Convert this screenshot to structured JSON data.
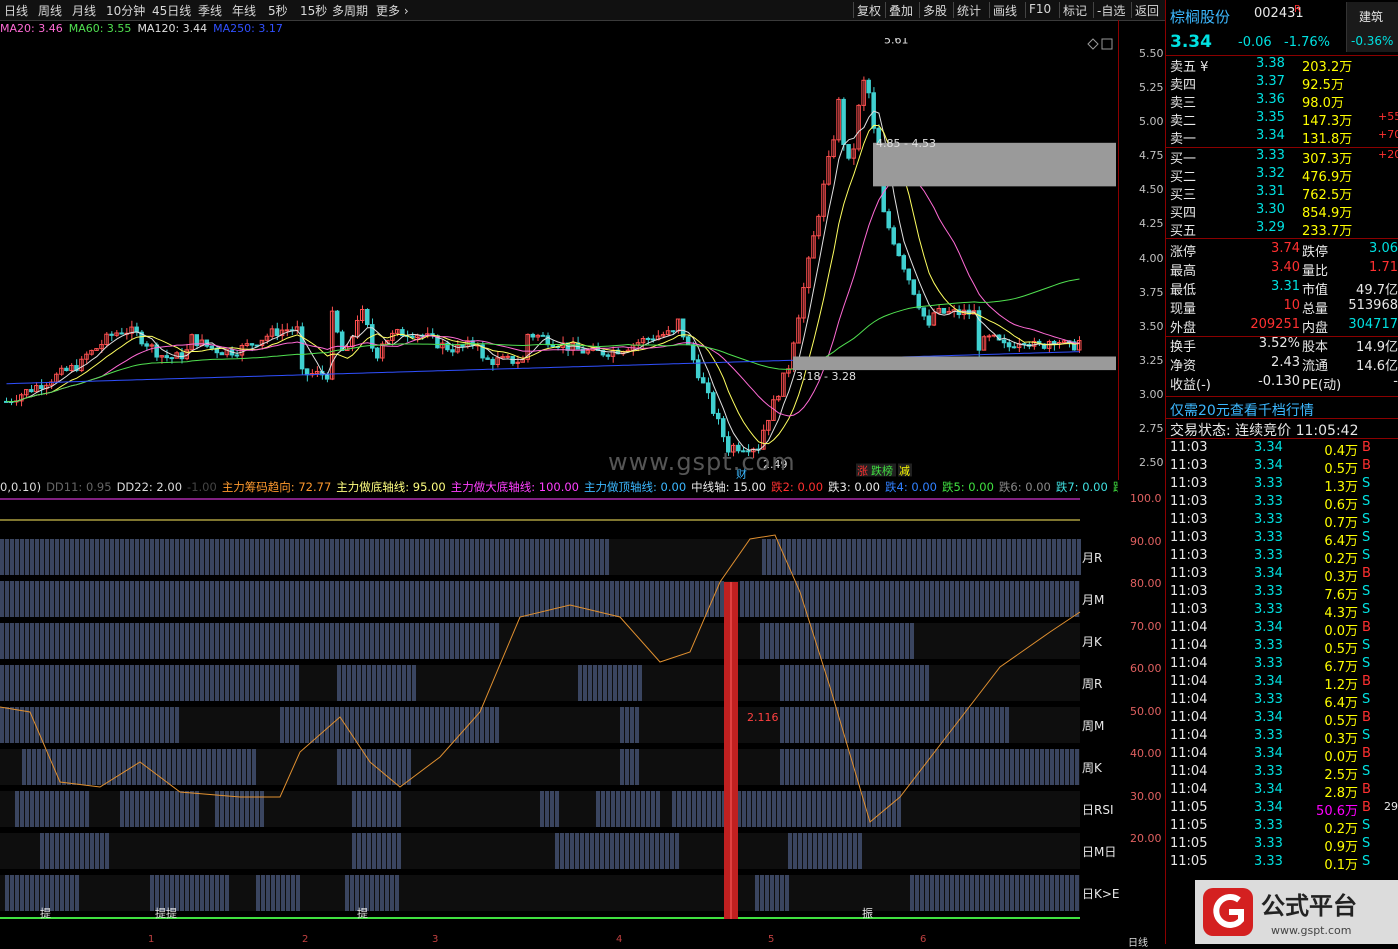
{
  "toolbar": {
    "left": [
      "日线",
      "周线",
      "月线",
      "10分钟",
      "45日线",
      "季线",
      "年线",
      "5秒",
      "15秒",
      "多周期",
      "更多"
    ],
    "right": [
      "复权",
      "叠加",
      "多股",
      "统计",
      "画线",
      "F10",
      "标记",
      "-自选",
      "返回"
    ]
  },
  "ma_legend": [
    {
      "label": "MA20: 3.46",
      "color": "#ff6ad5"
    },
    {
      "label": "MA60: 3.55",
      "color": "#50e050"
    },
    {
      "label": "MA120: 3.44",
      "color": "#e0e0e0"
    },
    {
      "label": "MA250: 3.17",
      "color": "#3050ff"
    }
  ],
  "price_axis": {
    "min": 2.38,
    "max": 5.62,
    "ticks": [
      "5.50",
      "5.25",
      "5.00",
      "4.75",
      "4.50",
      "4.25",
      "4.00",
      "3.75",
      "3.50",
      "3.25",
      "3.00",
      "2.75",
      "2.50"
    ]
  },
  "annotations": {
    "high": "5.61",
    "zone_upper": "4.85 - 4.53",
    "zone_lower": "3.18 - 3.28",
    "low": "2.49",
    "cai": "财",
    "tags": [
      "涨",
      "跌榜",
      "减"
    ]
  },
  "watermark": "www.gspt.com",
  "indicator_bar": [
    {
      "t": "0,0.10)",
      "c": "#ddd"
    },
    {
      "t": "DD11: 0.95",
      "c": "#666"
    },
    {
      "t": "DD22: 2.00",
      "c": "#ddd"
    },
    {
      "t": "-1.00",
      "c": "#444"
    },
    {
      "t": "主力筹码趋向: 72.77",
      "c": "#ff9a2e"
    },
    {
      "t": "主力做底轴线: 95.00",
      "c": "#ffff80"
    },
    {
      "t": "主力做大底轴线: 100.00",
      "c": "#ff40ff"
    },
    {
      "t": "主力做顶轴线: 0.00",
      "c": "#3cb8ff"
    },
    {
      "t": "中线轴: 15.00",
      "c": "#e8e8e8"
    },
    {
      "t": "跌2: 0.00",
      "c": "#ff3030"
    },
    {
      "t": "跌3: 0.00",
      "c": "#e8e8e8"
    },
    {
      "t": "跌4: 0.00",
      "c": "#3080ff"
    },
    {
      "t": "跌5: 0.00",
      "c": "#40e040"
    },
    {
      "t": "跌6: 0.00",
      "c": "#888"
    },
    {
      "t": "跌7: 0.00",
      "c": "#40e0e0"
    },
    {
      "t": "跌8: 0.",
      "c": "#40e040"
    }
  ],
  "sub_axis_ticks": [
    "100.0",
    "90.00",
    "80.00",
    "70.00",
    "60.00",
    "50.00",
    "40.00",
    "30.00",
    "20.00"
  ],
  "sub_labels": [
    "月R",
    "月M",
    "月K",
    "周R",
    "周M",
    "周K",
    "日RSI",
    "日M日",
    "日K>E"
  ],
  "sub_value_label": "2.116",
  "sub_small_labels": [
    "提",
    "提提",
    "提",
    "振"
  ],
  "bottom_ticks": [
    "1",
    "2",
    "3",
    "4",
    "5",
    "6"
  ],
  "bottom_right": "日线",
  "quote": {
    "name": "棕榈股份",
    "code": "002431",
    "badge": "R",
    "jz_label": "建筑",
    "jz_pct": "-0.36%",
    "price": "3.34",
    "change": "-0.06",
    "change_pct": "-1.76%",
    "asks": [
      {
        "l": "卖五",
        "p": "3.38",
        "v": "203.2万",
        "x": ""
      },
      {
        "l": "卖四",
        "p": "3.37",
        "v": "92.5万",
        "x": ""
      },
      {
        "l": "卖三",
        "p": "3.36",
        "v": "98.0万",
        "x": ""
      },
      {
        "l": "卖二",
        "p": "3.35",
        "v": "147.3万",
        "x": "+55"
      },
      {
        "l": "卖一",
        "p": "3.34",
        "v": "131.8万",
        "x": "+70"
      }
    ],
    "ask_mark": "¥",
    "bids": [
      {
        "l": "买一",
        "p": "3.33",
        "v": "307.3万",
        "x": "+20"
      },
      {
        "l": "买二",
        "p": "3.32",
        "v": "476.9万",
        "x": ""
      },
      {
        "l": "买三",
        "p": "3.31",
        "v": "762.5万",
        "x": ""
      },
      {
        "l": "买四",
        "p": "3.30",
        "v": "854.9万",
        "x": ""
      },
      {
        "l": "买五",
        "p": "3.29",
        "v": "233.7万",
        "x": ""
      }
    ],
    "stats": [
      {
        "a": "涨停",
        "av": "3.74",
        "ac": "red",
        "b": "跌停",
        "bv": "3.06",
        "bc": "grn"
      },
      {
        "a": "最高",
        "av": "3.40",
        "ac": "red",
        "b": "量比",
        "bv": "1.71",
        "bc": "red"
      },
      {
        "a": "最低",
        "av": "3.31",
        "ac": "grn",
        "b": "市值",
        "bv": "49.7亿",
        "bc": "wht"
      },
      {
        "a": "现量",
        "av": "10",
        "ac": "red",
        "b": "总量",
        "bv": "513968",
        "bc": "wht"
      },
      {
        "a": "外盘",
        "av": "209251",
        "ac": "red",
        "b": "内盘",
        "bv": "304717",
        "bc": "grn"
      },
      {
        "a": "换手",
        "av": "3.52%",
        "ac": "wht",
        "b": "股本",
        "bv": "14.9亿",
        "bc": "wht"
      },
      {
        "a": "净资",
        "av": "2.43",
        "ac": "wht",
        "b": "流通",
        "bv": "14.6亿",
        "bc": "wht"
      },
      {
        "a": "收益(-)",
        "av": "-0.130",
        "ac": "wht",
        "b": "PE(动)",
        "bv": "-",
        "bc": "wht"
      }
    ],
    "notice": "仅需20元查看千档行情",
    "trade_status": "交易状态: 连续竞价 11:05:42",
    "ticks": [
      [
        "11:03",
        "3.34",
        "0.4万",
        "B",
        ""
      ],
      [
        "11:03",
        "3.34",
        "0.5万",
        "B",
        ""
      ],
      [
        "11:03",
        "3.33",
        "1.3万",
        "S",
        ""
      ],
      [
        "11:03",
        "3.33",
        "0.6万",
        "S",
        ""
      ],
      [
        "11:03",
        "3.33",
        "0.7万",
        "S",
        ""
      ],
      [
        "11:03",
        "3.33",
        "6.4万",
        "S",
        ""
      ],
      [
        "11:03",
        "3.33",
        "0.2万",
        "S",
        ""
      ],
      [
        "11:03",
        "3.34",
        "0.3万",
        "B",
        ""
      ],
      [
        "11:03",
        "3.33",
        "7.6万",
        "S",
        ""
      ],
      [
        "11:03",
        "3.33",
        "4.3万",
        "S",
        ""
      ],
      [
        "11:04",
        "3.34",
        "0.0万",
        "B",
        ""
      ],
      [
        "11:04",
        "3.33",
        "0.5万",
        "S",
        ""
      ],
      [
        "11:04",
        "3.33",
        "6.7万",
        "S",
        ""
      ],
      [
        "11:04",
        "3.34",
        "1.2万",
        "B",
        ""
      ],
      [
        "11:04",
        "3.33",
        "6.4万",
        "S",
        ""
      ],
      [
        "11:04",
        "3.34",
        "0.5万",
        "B",
        ""
      ],
      [
        "11:04",
        "3.33",
        "0.3万",
        "S",
        ""
      ],
      [
        "11:04",
        "3.34",
        "0.0万",
        "B",
        ""
      ],
      [
        "11:04",
        "3.33",
        "2.5万",
        "S",
        ""
      ],
      [
        "11:04",
        "3.34",
        "2.8万",
        "B",
        ""
      ],
      [
        "11:05",
        "3.34",
        "50.6万",
        "B",
        "29"
      ],
      [
        "11:05",
        "3.33",
        "0.2万",
        "S",
        ""
      ],
      [
        "11:05",
        "3.33",
        "0.9万",
        "S",
        ""
      ],
      [
        "11:05",
        "3.33",
        "0.1万",
        "S",
        ""
      ]
    ]
  },
  "logo": {
    "text": "公式平台",
    "url_text": "www.gspt.com"
  }
}
